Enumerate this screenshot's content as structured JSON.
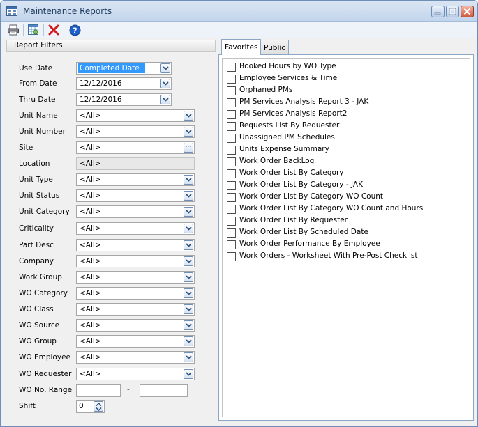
{
  "window": {
    "title": "Maintenance Reports"
  },
  "toolbar": {
    "print_icon": "printer-icon",
    "preview_icon": "report-grid-icon",
    "delete_icon": "red-x-icon",
    "help_icon": "help-icon"
  },
  "filters": {
    "header": "Report Filters",
    "rows": [
      {
        "label": "Use Date",
        "value": "Completed Date",
        "type": "combo-short",
        "selected": true
      },
      {
        "label": "From Date",
        "value": "12/12/2016",
        "type": "combo-short"
      },
      {
        "label": "Thru Date",
        "value": "12/12/2016",
        "type": "combo-short"
      },
      {
        "label": "Unit Name",
        "value": "<All>",
        "type": "combo"
      },
      {
        "label": "Unit Number",
        "value": "<All>",
        "type": "combo"
      },
      {
        "label": "Site",
        "value": "<All>",
        "type": "lookup"
      },
      {
        "label": "Location",
        "value": "<All>",
        "type": "disabled"
      },
      {
        "label": "Unit Type",
        "value": "<All>",
        "type": "combo"
      },
      {
        "label": "Unit Status",
        "value": "<All>",
        "type": "combo"
      },
      {
        "label": "Unit Category",
        "value": "<All>",
        "type": "combo"
      },
      {
        "label": "Criticality",
        "value": "<All>",
        "type": "combo"
      },
      {
        "label": "Part Desc",
        "value": "<All>",
        "type": "combo"
      },
      {
        "label": "Company",
        "value": "<All>",
        "type": "combo"
      },
      {
        "label": "Work Group",
        "value": "<All>",
        "type": "combo"
      },
      {
        "label": "WO Category",
        "value": "<All>",
        "type": "combo"
      },
      {
        "label": "WO Class",
        "value": "<All>",
        "type": "combo"
      },
      {
        "label": "WO Source",
        "value": "<All>",
        "type": "combo"
      },
      {
        "label": "WO Group",
        "value": "<All>",
        "type": "combo"
      },
      {
        "label": "WO Employee",
        "value": "<All>",
        "type": "combo"
      },
      {
        "label": "WO Requester",
        "value": "<All>",
        "type": "combo"
      }
    ],
    "wo_range": {
      "label": "WO No. Range",
      "from": "",
      "to": "",
      "separator": "-"
    },
    "shift": {
      "label": "Shift",
      "value": "0"
    }
  },
  "tabs": [
    {
      "label": "Favorites",
      "active": true
    },
    {
      "label": "Public",
      "active": false
    }
  ],
  "reports": [
    {
      "label": "Booked Hours by WO Type",
      "checked": false
    },
    {
      "label": "Employee Services & Time",
      "checked": false
    },
    {
      "label": "Orphaned PMs",
      "checked": false
    },
    {
      "label": "PM Services Analysis Report 3 - JAK",
      "checked": false
    },
    {
      "label": "PM Services Analysis Report2",
      "checked": false
    },
    {
      "label": "Requests List By Requester",
      "checked": false
    },
    {
      "label": "Unassigned PM Schedules",
      "checked": false
    },
    {
      "label": "Units Expense Summary",
      "checked": false
    },
    {
      "label": "Work Order BackLog",
      "checked": false
    },
    {
      "label": "Work Order List By Category",
      "checked": false
    },
    {
      "label": "Work Order List By Category - JAK",
      "checked": false
    },
    {
      "label": "Work Order List By Category WO Count",
      "checked": false
    },
    {
      "label": "Work Order List By Category WO Count and Hours",
      "checked": false
    },
    {
      "label": "Work Order List By Requester",
      "checked": false
    },
    {
      "label": "Work Order List By Scheduled Date",
      "checked": false
    },
    {
      "label": "Work Order Performance By Employee",
      "checked": false
    },
    {
      "label": "Work Orders - Worksheet With Pre-Post Checklist",
      "checked": false
    }
  ]
}
